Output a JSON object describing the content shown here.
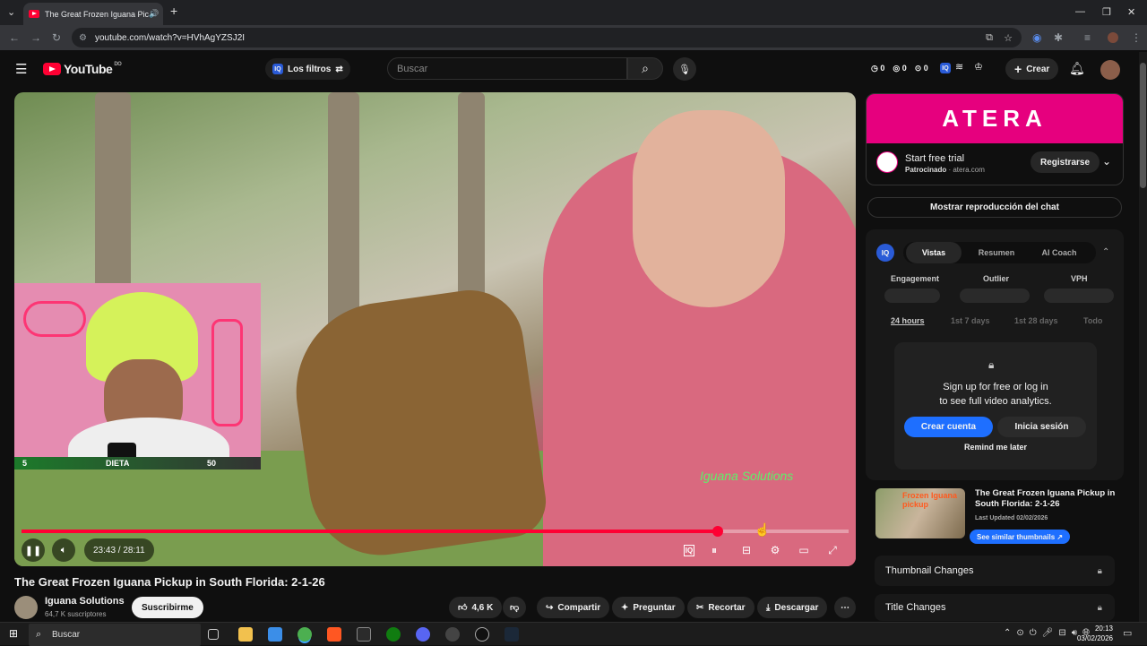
{
  "browser": {
    "tab_title": "The Great Frozen Iguana Pic",
    "url": "youtube.com/watch?v=HVhAgYZSJ2I"
  },
  "header": {
    "logo": "YouTube",
    "region": "DO",
    "filters_label": "Los filtros",
    "search_placeholder": "Buscar",
    "counts": [
      "0",
      "0",
      "0"
    ],
    "create_label": "Crear"
  },
  "video": {
    "pip_sign": "",
    "watermark": "Iguana Solutions",
    "chapter_left": "5",
    "chapter_label": "DIETA",
    "chapter_right": "50",
    "time": "23:43 / 28:11",
    "progress_fraction": 0.8415
  },
  "below": {
    "title": "The Great Frozen Iguana Pickup in South Florida: 2-1-26",
    "channel": "Iguana Solutions",
    "subscribers": "64,7 K suscriptores",
    "subscribe": "Suscribirme",
    "likes": "4,6 K",
    "share": "Compartir",
    "ask": "Preguntar",
    "clip": "Recortar",
    "download": "Descargar"
  },
  "sidebar": {
    "ad_brand": "ATERA",
    "ad_title": "Start free trial",
    "ad_sponsored": "Patrocinado",
    "ad_domain": "atera.com",
    "ad_cta": "Registrarse",
    "chat_button": "Mostrar reproducción del chat",
    "tabs": [
      "Vistas",
      "Resumen",
      "AI Coach"
    ],
    "metrics": [
      "Engagement",
      "Outlier",
      "VPH"
    ],
    "periods": [
      "24 hours",
      "1st 7 days",
      "1st 28 days",
      "Todo"
    ],
    "lock_line1": "Sign up for free or log in",
    "lock_line2": "to see full video analytics.",
    "create_account": "Crear cuenta",
    "login": "Inicia sesión",
    "remind": "Remind me later",
    "rec_title": "The Great Frozen Iguana Pickup in South Florida: 2-1-26",
    "rec_updated": "Last Updated 02/02/2026",
    "rec_thumb_text": "Frozen Iguana pickup",
    "similar": "See similar thumbnails",
    "thumb_changes": "Thumbnail Changes",
    "title_changes": "Title Changes"
  },
  "taskbar": {
    "search": "Buscar",
    "time": "20:13",
    "date": "03/02/2026"
  }
}
